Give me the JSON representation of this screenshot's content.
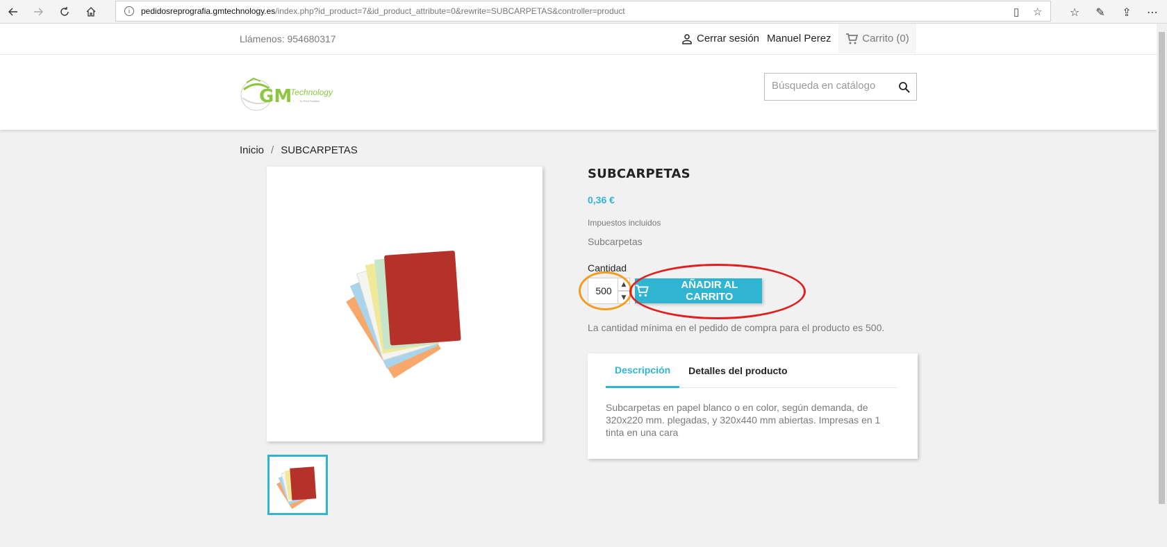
{
  "browser": {
    "url_host": "pedidosreprografia.gmtechnology.es",
    "url_path": "/index.php?id_product=7&id_product_attribute=0&rewrite=SUBCARPETAS&controller=product"
  },
  "header": {
    "phone": "Llámenos: 954680317",
    "logout_label": "Cerrar sesión",
    "user_name": "Manuel Perez",
    "cart_label": "Carrito (0)",
    "search_placeholder": "Búsqueda en catálogo"
  },
  "logo": {
    "brand": "GM",
    "word": "Technology",
    "tagline": "Tu Print Solution"
  },
  "breadcrumb": {
    "home": "Inicio",
    "separator": "/",
    "current": "SUBCARPETAS"
  },
  "product": {
    "title": "SUBCARPETAS",
    "price": "0,36 €",
    "tax_note": "Impuestos incluidos",
    "short_description": "Subcarpetas",
    "quantity_label": "Cantidad",
    "quantity_value": "500",
    "add_to_cart_label": "AÑADIR AL CARRITO",
    "min_quantity_note": "La cantidad mínima en el pedido de compra para el producto es 500."
  },
  "tabs": {
    "items": [
      {
        "label": "Descripción",
        "active": true
      },
      {
        "label": "Detalles del producto",
        "active": false
      }
    ],
    "description": "Subcarpetas en papel blanco o en color, según demanda, de 320x220 mm. plegadas, y 320x440 mm abiertas. Impresas en 1 tinta en una cara"
  },
  "colors": {
    "accent": "#2fb5d2",
    "folder_red": "#b5322b",
    "annotation_orange": "#f39c1f",
    "annotation_red": "#e02020"
  }
}
